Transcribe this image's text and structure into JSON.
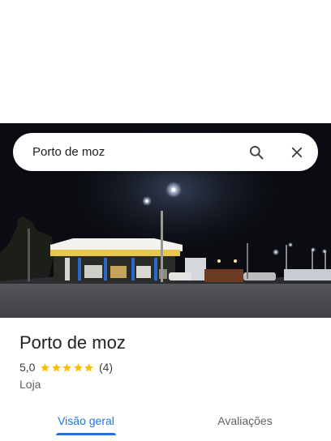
{
  "search": {
    "query": "Porto de moz"
  },
  "place": {
    "name": "Porto de moz",
    "rating": "5,0",
    "rating_value": 5,
    "review_count": "(4)",
    "category": "Loja"
  },
  "tabs": [
    {
      "label": "Visão geral",
      "active": true
    },
    {
      "label": "Avaliações",
      "active": false
    }
  ],
  "icons": {
    "search": "search-icon",
    "close": "close-icon",
    "star": "star-icon"
  },
  "colors": {
    "accent": "#1a73e8",
    "star": "#fbbc04",
    "text_primary": "#202124",
    "text_secondary": "#5f6368"
  }
}
